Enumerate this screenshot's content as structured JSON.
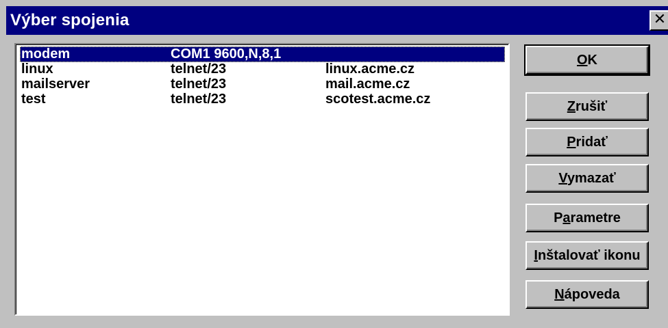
{
  "window": {
    "title": "Výber spojenia",
    "close_glyph": "✕"
  },
  "connections": [
    {
      "name": "modem",
      "type": "COM1 9600,N,8,1",
      "host": "",
      "selected": true
    },
    {
      "name": "linux",
      "type": "telnet/23",
      "host": "linux.acme.cz",
      "selected": false
    },
    {
      "name": "mailserver",
      "type": "telnet/23",
      "host": "mail.acme.cz",
      "selected": false
    },
    {
      "name": "test",
      "type": "telnet/23",
      "host": "scotest.acme.cz",
      "selected": false
    }
  ],
  "buttons": {
    "ok": {
      "pre": "",
      "mn": "O",
      "post": "K"
    },
    "cancel": {
      "pre": "",
      "mn": "Z",
      "post": "rušiť"
    },
    "add": {
      "pre": "",
      "mn": "P",
      "post": "ridať"
    },
    "delete": {
      "pre": "",
      "mn": "V",
      "post": "ymazať"
    },
    "parameters": {
      "pre": "P",
      "mn": "a",
      "post": "rametre"
    },
    "install_icon": {
      "pre": "",
      "mn": "I",
      "post": "nštalovať ikonu"
    },
    "help": {
      "pre": "",
      "mn": "N",
      "post": "ápoveda"
    }
  },
  "colors": {
    "titlebar": "#000080",
    "face": "#c0c0c0",
    "selection": "#000080"
  }
}
